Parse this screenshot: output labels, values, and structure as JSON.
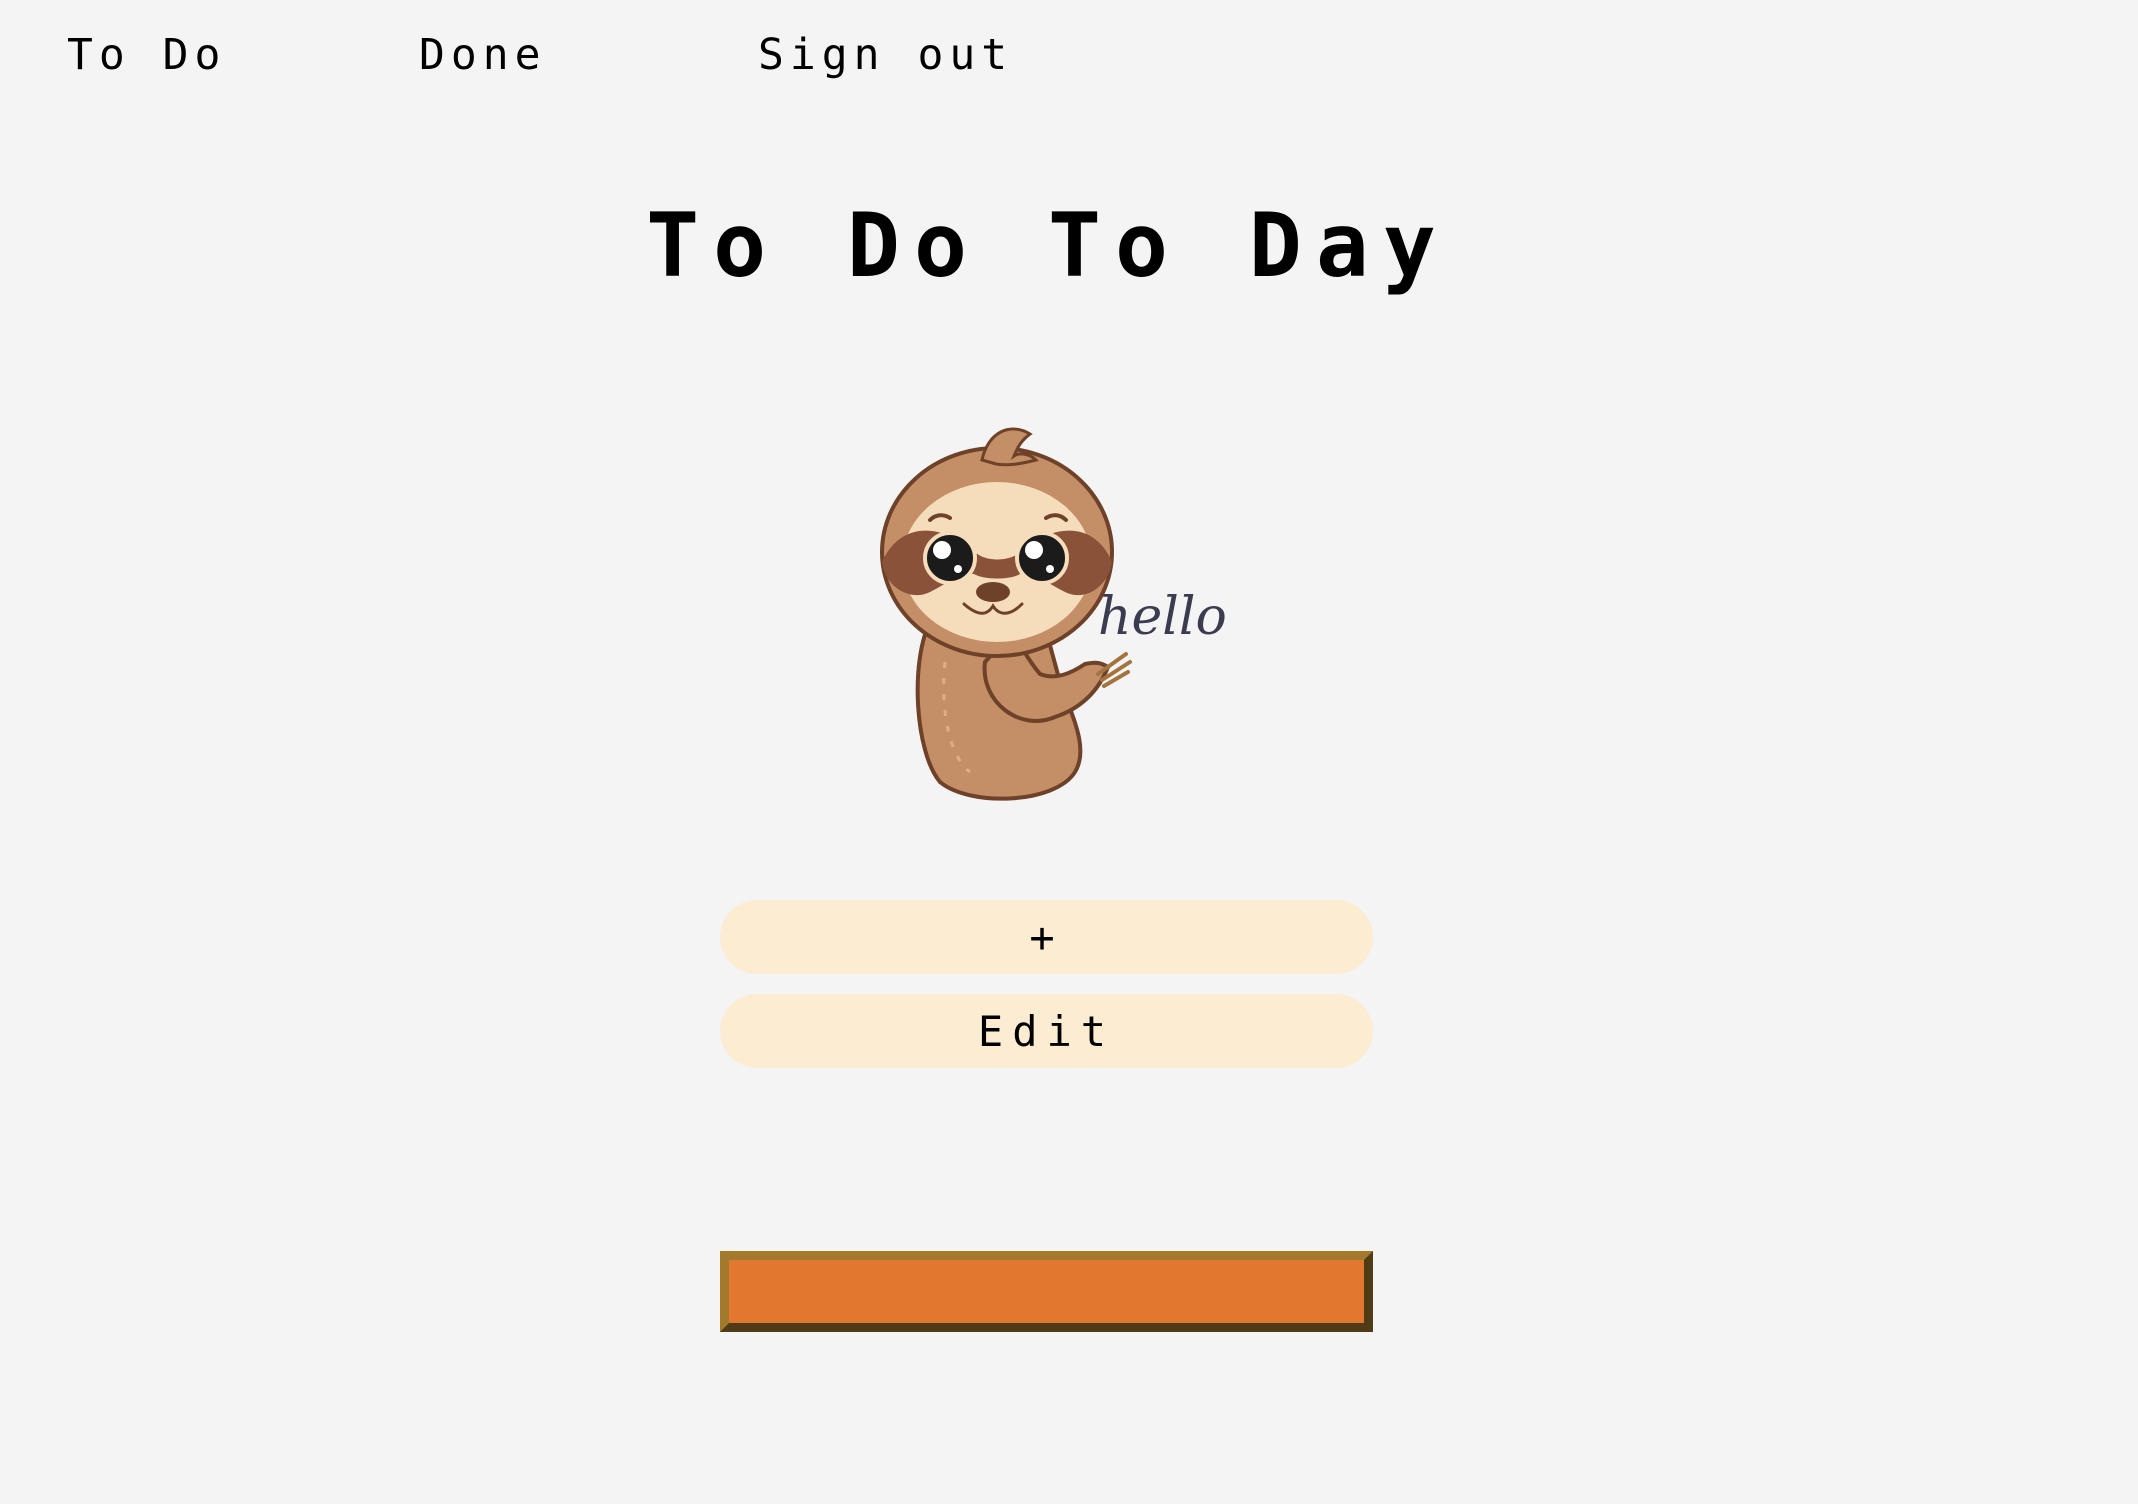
{
  "nav": {
    "todo_label": "To Do",
    "done_label": "Done",
    "signout_label": "Sign out"
  },
  "page": {
    "title": "To Do To Day",
    "mascot_caption": "hello"
  },
  "actions": {
    "add_label": "+",
    "edit_label": "Edit"
  },
  "input": {
    "value": "",
    "placeholder": ""
  },
  "colors": {
    "background": "#f4f4f4",
    "button_fill": "#fbecd2",
    "input_fill": "#e2772f",
    "input_border": "#a37a2c",
    "sloth_fur": "#c48e67",
    "sloth_face": "#f5dcba",
    "sloth_mask": "#8a5238"
  },
  "icons": {
    "mascot": "sloth-hello-illustration"
  }
}
